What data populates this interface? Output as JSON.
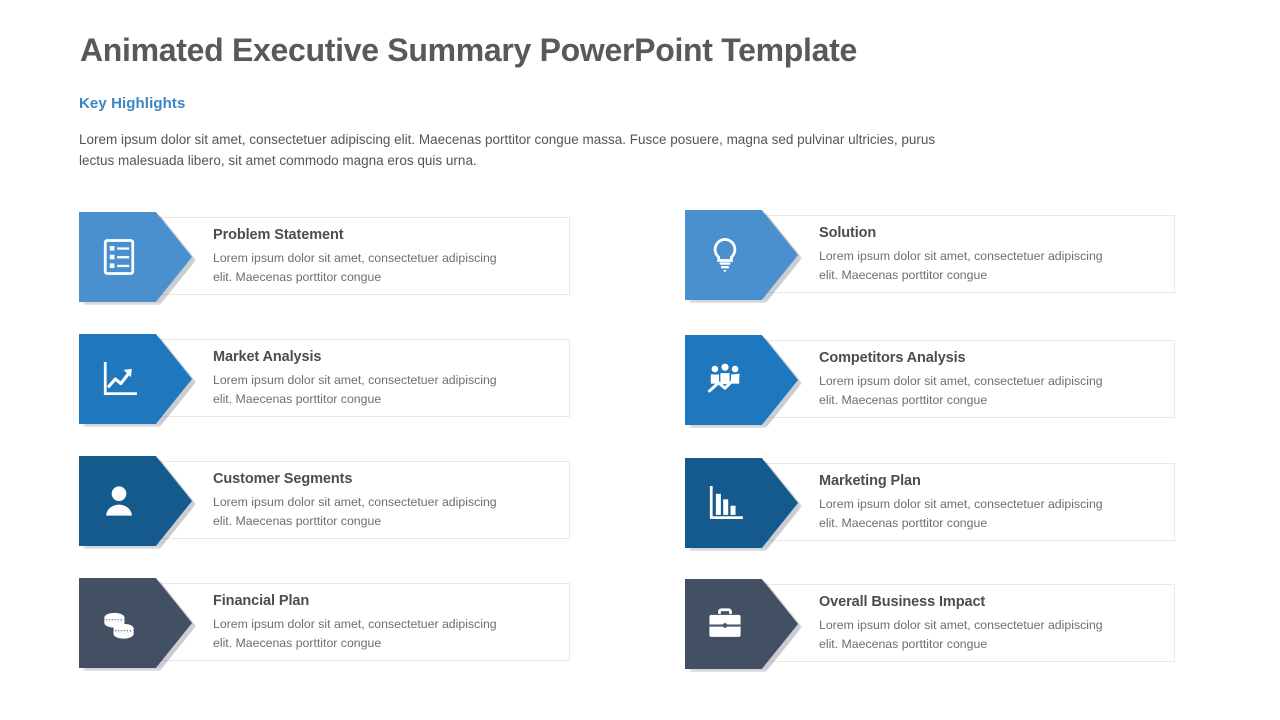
{
  "slide": {
    "title": "Animated Executive Summary PowerPoint Template",
    "section_label": "Key Highlights",
    "intro_paragraph": "Lorem ipsum dolor sit amet, consectetuer adipiscing elit.  Maecenas porttitor congue massa. Fusce posuere, magna sed pulvinar ultricies, purus lectus malesuada libero, sit amet commodo magna eros quis urna."
  },
  "palette": {
    "title_gray": "#595959",
    "accent_blue": "#3a85c4",
    "body_gray": "#555555",
    "card_border": "#e9e9e9",
    "row1_blue": "#4a90ce",
    "row2_blue": "#1f77be",
    "row3_blue": "#145a8d",
    "row4_slate": "#434f63"
  },
  "cards": {
    "left": [
      {
        "title": "Problem Statement",
        "description": "Lorem ipsum dolor sit amet, consectetuer adipiscing elit. Maecenas porttitor congue",
        "icon": "checklist-icon",
        "color": "#4a90ce"
      },
      {
        "title": "Market Analysis",
        "description": "Lorem ipsum dolor sit amet, consectetuer adipiscing elit. Maecenas porttitor congue",
        "icon": "line-chart-up-icon",
        "color": "#1f77be"
      },
      {
        "title": "Customer Segments",
        "description": "Lorem ipsum dolor sit amet, consectetuer adipiscing elit. Maecenas porttitor congue",
        "icon": "person-icon",
        "color": "#145a8d"
      },
      {
        "title": "Financial Plan",
        "description": "Lorem ipsum dolor sit amet, consectetuer adipiscing elit. Maecenas porttitor congue",
        "icon": "coins-icon",
        "color": "#434f63"
      }
    ],
    "right": [
      {
        "title": "Solution",
        "description": "Lorem ipsum dolor sit amet, consectetuer adipiscing elit. Maecenas porttitor congue",
        "icon": "lightbulb-icon",
        "color": "#4a90ce"
      },
      {
        "title": "Competitors Analysis",
        "description": "Lorem ipsum dolor sit amet, consectetuer adipiscing elit. Maecenas porttitor congue",
        "icon": "people-trend-icon",
        "color": "#1f77be"
      },
      {
        "title": "Marketing Plan",
        "description": "Lorem ipsum dolor sit amet, consectetuer adipiscing elit. Maecenas porttitor congue",
        "icon": "bar-chart-icon",
        "color": "#145a8d"
      },
      {
        "title": "Overall Business Impact",
        "description": "Lorem ipsum dolor sit amet, consectetuer adipiscing elit. Maecenas porttitor congue",
        "icon": "briefcase-icon",
        "color": "#434f63"
      }
    ]
  }
}
